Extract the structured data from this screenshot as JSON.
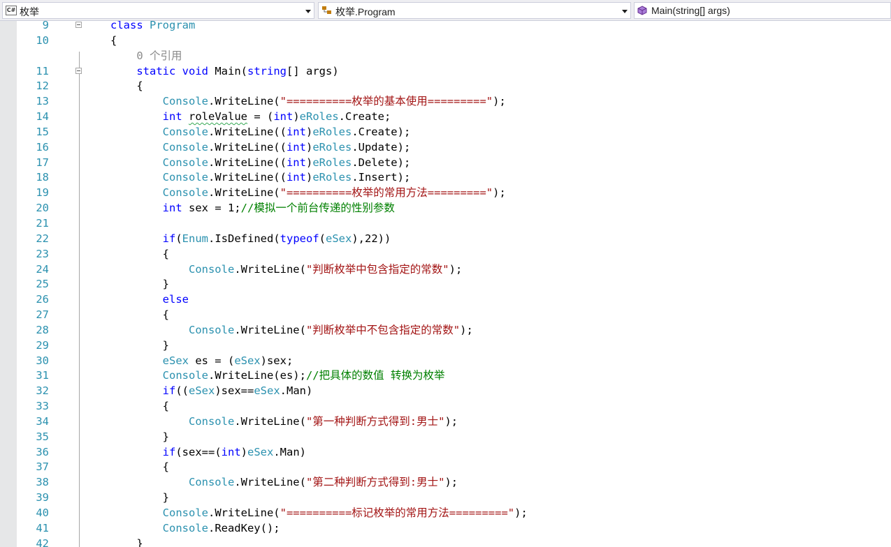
{
  "navbar": {
    "project_combo": {
      "icon": "csharp-file-icon",
      "label": "枚举"
    },
    "class_combo": {
      "icon": "class-icon",
      "label": "枚举.Program"
    },
    "member_combo": {
      "icon": "method-icon",
      "label": "Main(string[] args)"
    }
  },
  "colors": {
    "keyword": "#0000ff",
    "type": "#2b91af",
    "string": "#a31515",
    "comment": "#008000",
    "line_number": "#2b91af",
    "codelens": "#8a8a8a"
  },
  "editor": {
    "lines": [
      {
        "num": "9",
        "tokens": [
          [
            "kw",
            "class"
          ],
          [
            "",
            " "
          ],
          [
            "ty",
            "Program"
          ]
        ]
      },
      {
        "num": "10",
        "tokens": [
          [
            "",
            "{"
          ]
        ]
      },
      {
        "num": "",
        "codelens": true,
        "tokens": [
          [
            "lens",
            "    0 个引用"
          ]
        ]
      },
      {
        "num": "11",
        "tokens": [
          [
            "",
            "    "
          ],
          [
            "kw",
            "static"
          ],
          [
            "",
            " "
          ],
          [
            "kw",
            "void"
          ],
          [
            "",
            " Main("
          ],
          [
            "kw",
            "string"
          ],
          [
            "",
            "[] args)"
          ]
        ]
      },
      {
        "num": "12",
        "tokens": [
          [
            "",
            "    {"
          ]
        ]
      },
      {
        "num": "13",
        "tokens": [
          [
            "",
            "        "
          ],
          [
            "ty",
            "Console"
          ],
          [
            "",
            ".WriteLine("
          ],
          [
            "st",
            "\"==========枚举的基本使用=========\""
          ],
          [
            "",
            ");"
          ]
        ]
      },
      {
        "num": "14",
        "tokens": [
          [
            "",
            "        "
          ],
          [
            "kw",
            "int"
          ],
          [
            "",
            " "
          ],
          [
            "squig",
            "roleValue"
          ],
          [
            "",
            " = ("
          ],
          [
            "kw",
            "int"
          ],
          [
            "",
            ")"
          ],
          [
            "ty",
            "eRoles"
          ],
          [
            "",
            ".Create;"
          ]
        ]
      },
      {
        "num": "15",
        "tokens": [
          [
            "",
            "        "
          ],
          [
            "ty",
            "Console"
          ],
          [
            "",
            ".WriteLine(("
          ],
          [
            "kw",
            "int"
          ],
          [
            "",
            ")"
          ],
          [
            "ty",
            "eRoles"
          ],
          [
            "",
            ".Create);"
          ]
        ]
      },
      {
        "num": "16",
        "tokens": [
          [
            "",
            "        "
          ],
          [
            "ty",
            "Console"
          ],
          [
            "",
            ".WriteLine(("
          ],
          [
            "kw",
            "int"
          ],
          [
            "",
            ")"
          ],
          [
            "ty",
            "eRoles"
          ],
          [
            "",
            ".Update);"
          ]
        ]
      },
      {
        "num": "17",
        "tokens": [
          [
            "",
            "        "
          ],
          [
            "ty",
            "Console"
          ],
          [
            "",
            ".WriteLine(("
          ],
          [
            "kw",
            "int"
          ],
          [
            "",
            ")"
          ],
          [
            "ty",
            "eRoles"
          ],
          [
            "",
            ".Delete);"
          ]
        ]
      },
      {
        "num": "18",
        "tokens": [
          [
            "",
            "        "
          ],
          [
            "ty",
            "Console"
          ],
          [
            "",
            ".WriteLine(("
          ],
          [
            "kw",
            "int"
          ],
          [
            "",
            ")"
          ],
          [
            "ty",
            "eRoles"
          ],
          [
            "",
            ".Insert);"
          ]
        ]
      },
      {
        "num": "19",
        "tokens": [
          [
            "",
            "        "
          ],
          [
            "ty",
            "Console"
          ],
          [
            "",
            ".WriteLine("
          ],
          [
            "st",
            "\"==========枚举的常用方法=========\""
          ],
          [
            "",
            ");"
          ]
        ]
      },
      {
        "num": "20",
        "tokens": [
          [
            "",
            "        "
          ],
          [
            "kw",
            "int"
          ],
          [
            "",
            " sex = 1;"
          ],
          [
            "cm",
            "//模拟一个前台传递的性别参数"
          ]
        ]
      },
      {
        "num": "21",
        "tokens": []
      },
      {
        "num": "22",
        "tokens": [
          [
            "",
            "        "
          ],
          [
            "kw",
            "if"
          ],
          [
            "",
            "("
          ],
          [
            "ty",
            "Enum"
          ],
          [
            "",
            ".IsDefined("
          ],
          [
            "kw",
            "typeof"
          ],
          [
            "",
            "("
          ],
          [
            "ty",
            "eSex"
          ],
          [
            "",
            "),22))"
          ]
        ]
      },
      {
        "num": "23",
        "tokens": [
          [
            "",
            "        {"
          ]
        ]
      },
      {
        "num": "24",
        "tokens": [
          [
            "",
            "            "
          ],
          [
            "ty",
            "Console"
          ],
          [
            "",
            ".WriteLine("
          ],
          [
            "st",
            "\"判断枚举中包含指定的常数\""
          ],
          [
            "",
            ");"
          ]
        ]
      },
      {
        "num": "25",
        "tokens": [
          [
            "",
            "        }"
          ]
        ]
      },
      {
        "num": "26",
        "tokens": [
          [
            "",
            "        "
          ],
          [
            "kw",
            "else"
          ]
        ]
      },
      {
        "num": "27",
        "tokens": [
          [
            "",
            "        {"
          ]
        ]
      },
      {
        "num": "28",
        "tokens": [
          [
            "",
            "            "
          ],
          [
            "ty",
            "Console"
          ],
          [
            "",
            ".WriteLine("
          ],
          [
            "st",
            "\"判断枚举中不包含指定的常数\""
          ],
          [
            "",
            ");"
          ]
        ]
      },
      {
        "num": "29",
        "tokens": [
          [
            "",
            "        }"
          ]
        ]
      },
      {
        "num": "30",
        "tokens": [
          [
            "",
            "        "
          ],
          [
            "ty",
            "eSex"
          ],
          [
            "",
            " es = ("
          ],
          [
            "ty",
            "eSex"
          ],
          [
            "",
            ")sex;"
          ]
        ]
      },
      {
        "num": "31",
        "tokens": [
          [
            "",
            "        "
          ],
          [
            "ty",
            "Console"
          ],
          [
            "",
            ".WriteLine(es);"
          ],
          [
            "cm",
            "//把具体的数值 转换为枚举"
          ]
        ]
      },
      {
        "num": "32",
        "tokens": [
          [
            "",
            "        "
          ],
          [
            "kw",
            "if"
          ],
          [
            "",
            "(("
          ],
          [
            "ty",
            "eSex"
          ],
          [
            "",
            ")sex=="
          ],
          [
            "ty",
            "eSex"
          ],
          [
            "",
            ".Man)"
          ]
        ]
      },
      {
        "num": "33",
        "tokens": [
          [
            "",
            "        {"
          ]
        ]
      },
      {
        "num": "34",
        "tokens": [
          [
            "",
            "            "
          ],
          [
            "ty",
            "Console"
          ],
          [
            "",
            ".WriteLine("
          ],
          [
            "st",
            "\"第一种判断方式得到:男士\""
          ],
          [
            "",
            ");"
          ]
        ]
      },
      {
        "num": "35",
        "tokens": [
          [
            "",
            "        }"
          ]
        ]
      },
      {
        "num": "36",
        "tokens": [
          [
            "",
            "        "
          ],
          [
            "kw",
            "if"
          ],
          [
            "",
            "(sex==("
          ],
          [
            "kw",
            "int"
          ],
          [
            "",
            ")"
          ],
          [
            "ty",
            "eSex"
          ],
          [
            "",
            ".Man)"
          ]
        ]
      },
      {
        "num": "37",
        "tokens": [
          [
            "",
            "        {"
          ]
        ]
      },
      {
        "num": "38",
        "tokens": [
          [
            "",
            "            "
          ],
          [
            "ty",
            "Console"
          ],
          [
            "",
            ".WriteLine("
          ],
          [
            "st",
            "\"第二种判断方式得到:男士\""
          ],
          [
            "",
            ");"
          ]
        ]
      },
      {
        "num": "39",
        "tokens": [
          [
            "",
            "        }"
          ]
        ]
      },
      {
        "num": "40",
        "tokens": [
          [
            "",
            "        "
          ],
          [
            "ty",
            "Console"
          ],
          [
            "",
            ".WriteLine("
          ],
          [
            "st",
            "\"==========标记枚举的常用方法=========\""
          ],
          [
            "",
            ");"
          ]
        ]
      },
      {
        "num": "41",
        "tokens": [
          [
            "",
            "        "
          ],
          [
            "ty",
            "Console"
          ],
          [
            "",
            ".ReadKey();"
          ]
        ]
      },
      {
        "num": "42",
        "tokens": [
          [
            "",
            "    }"
          ]
        ]
      }
    ],
    "fold_lines": [
      "9",
      "11"
    ]
  }
}
